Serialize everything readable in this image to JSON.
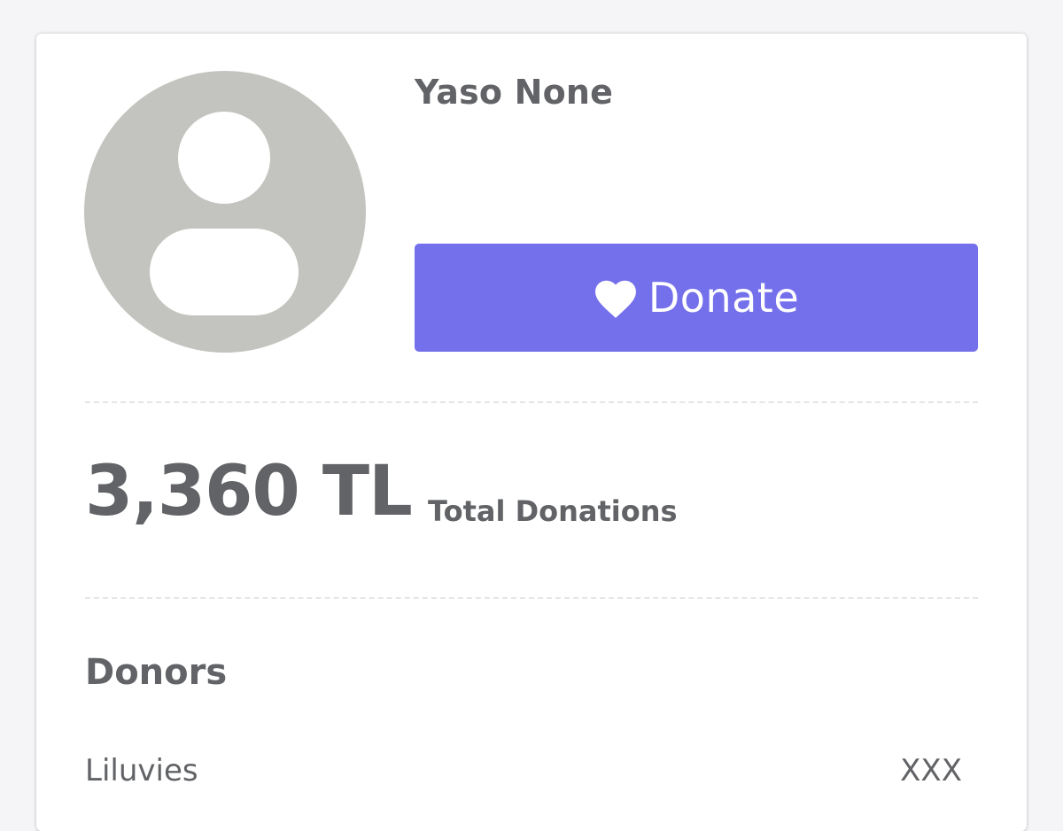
{
  "profile": {
    "name": "Yaso None",
    "avatar_icon": "user-icon"
  },
  "donate_button": {
    "label": "Donate",
    "icon": "heart-icon",
    "color": "#7470eb"
  },
  "stats": {
    "total_amount": "3,360 TL",
    "total_label": "Total Donations"
  },
  "donors": {
    "title": "Donors",
    "items": [
      {
        "name": "Liluvies",
        "amount": "XXX"
      }
    ]
  },
  "colors": {
    "text": "#616366",
    "avatar_bg": "#c3c4bf",
    "background": "#f5f5f8"
  }
}
